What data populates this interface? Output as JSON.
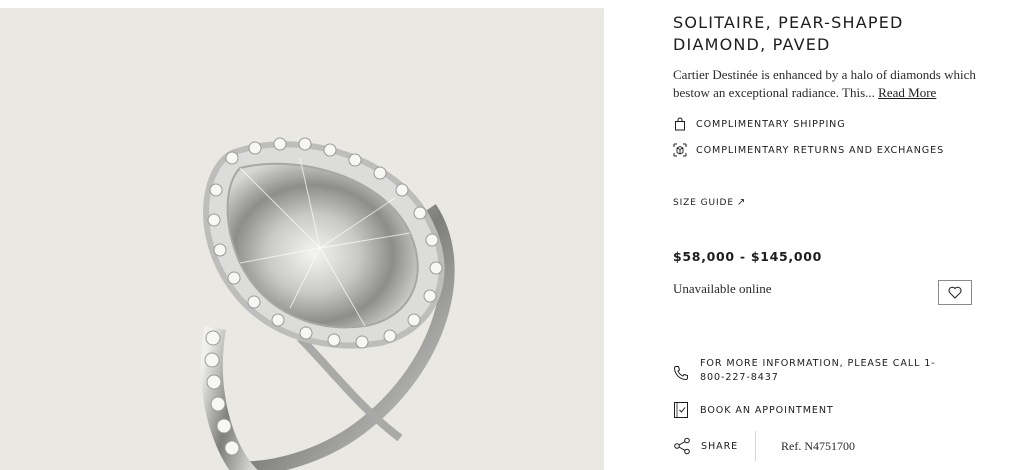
{
  "product": {
    "title": "SOLITAIRE, PEAR-SHAPED DIAMOND, PAVED",
    "description": "Cartier Destinée is enhanced by a halo of diamonds which bestow an exceptional radiance. This...",
    "read_more": "Read More",
    "image_alt_icon": "ring-image"
  },
  "perks": [
    {
      "label": "COMPLIMENTARY SHIPPING",
      "icon": "shopping-bag-icon"
    },
    {
      "label": "COMPLIMENTARY RETURNS AND EXCHANGES",
      "icon": "return-box-icon"
    }
  ],
  "size_guide": {
    "label": "SIZE GUIDE",
    "arrow": "↗"
  },
  "price": "$58,000 - $145,000",
  "availability": "Unavailable online",
  "wishlist": {
    "icon": "heart-icon"
  },
  "contact": {
    "label": "FOR MORE INFORMATION, PLEASE CALL 1-800-227-8437",
    "icon": "phone-icon"
  },
  "appointment": {
    "label": "BOOK AN APPOINTMENT",
    "icon": "calendar-check-icon"
  },
  "share": {
    "label": "SHARE",
    "icon": "share-icon"
  },
  "reference": "Ref. N4751700",
  "colors": {
    "image_bg": "#eae8e2",
    "text": "#1d1d1b"
  }
}
